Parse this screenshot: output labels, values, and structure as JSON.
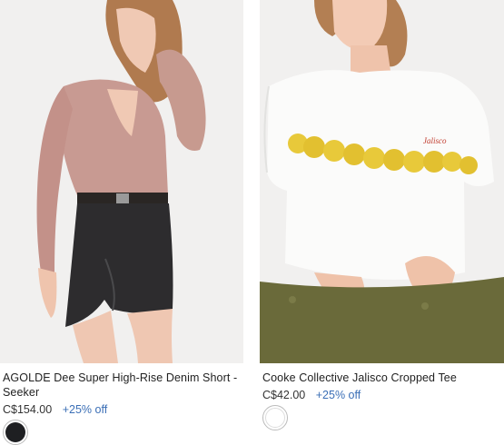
{
  "products": [
    {
      "title": "AGOLDE Dee Super High-Rise Denim Short - Seeker",
      "price": "C$154.00",
      "discount": "+25% off",
      "swatch_color": "#1e1f22",
      "image": "model-pink-ribbed-top-black-denim-shorts"
    },
    {
      "title": "Cooke Collective Jalisco Cropped Tee",
      "price": "C$42.00",
      "discount": "+25% off",
      "swatch_color": "#ffffff",
      "image": "model-white-tee-lemon-print-olive-pants"
    }
  ],
  "colors": {
    "accent": "#3b6fb6"
  }
}
